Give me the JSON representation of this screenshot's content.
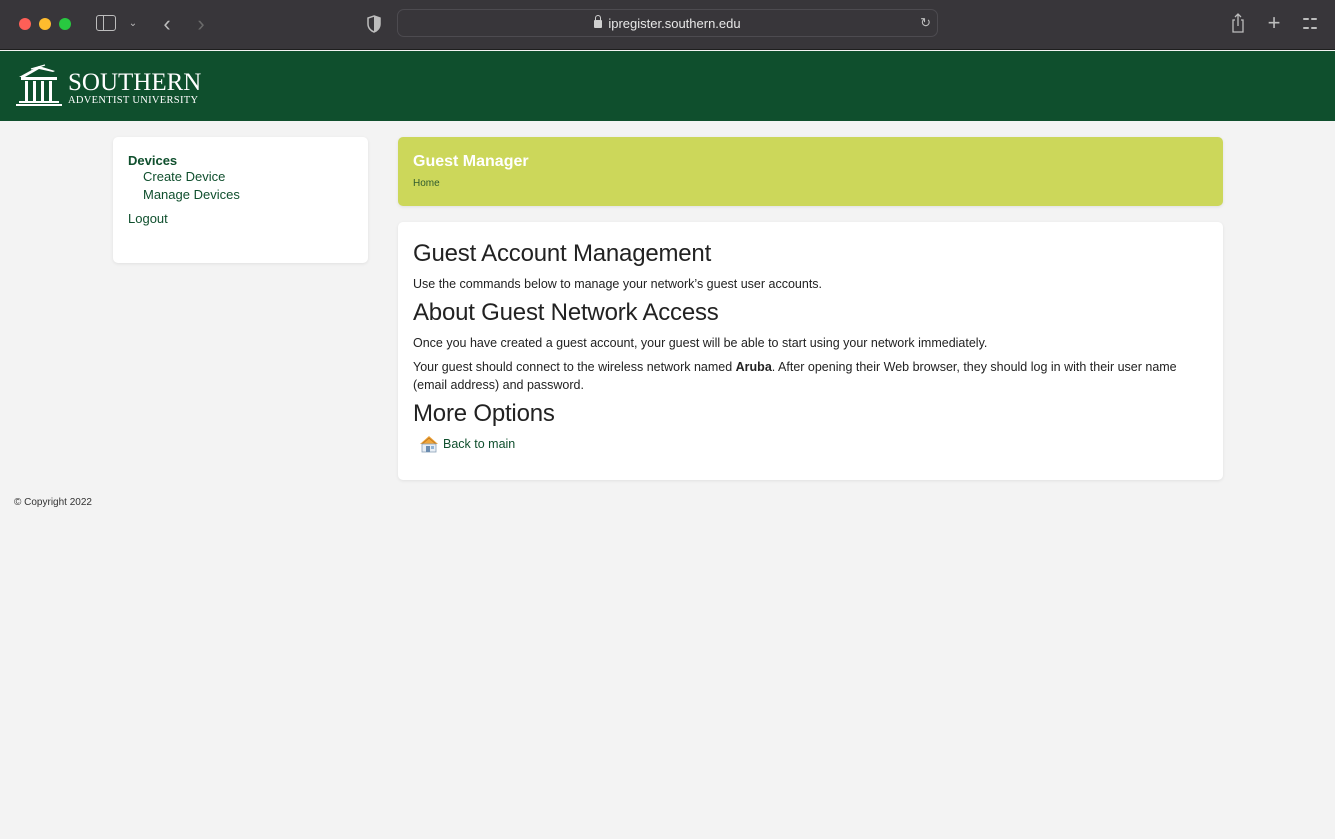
{
  "browser": {
    "url": "ipregister.southern.edu",
    "icons": [
      "sidebar-toggle-icon",
      "chevron-down-icon",
      "back-icon",
      "forward-icon",
      "shield-icon",
      "lock-icon",
      "reload-icon",
      "share-icon",
      "plus-icon",
      "tab-overview-icon"
    ]
  },
  "header": {
    "logo_main": "SOUTHERN",
    "logo_sub": "ADVENTIST UNIVERSITY"
  },
  "sidebar": {
    "section_title": "Devices",
    "items": [
      {
        "label": "Create Device"
      },
      {
        "label": "Manage Devices"
      }
    ],
    "logout_label": "Logout"
  },
  "title_box": {
    "title": "Guest Manager",
    "breadcrumb": "Home"
  },
  "content": {
    "heading1": "Guest Account Management",
    "intro": "Use the commands below to manage your network’s guest user accounts.",
    "heading2": "About Guest Network Access",
    "para1": "Once you have created a guest account, your guest will be able to start using your network immediately.",
    "para2_prefix": "Your guest should connect to the wireless network named ",
    "network_name": "Aruba",
    "para2_suffix": ". After opening their Web browser, they should log in with their user name (email address) and password.",
    "heading3": "More Options",
    "options": [
      {
        "icon": "home-icon",
        "label": "Back to main"
      }
    ]
  },
  "footer": {
    "copyright": "© Copyright 2022"
  },
  "colors": {
    "brand_green": "#0f4f2d",
    "title_lime": "#ccd75a",
    "page_bg": "#f3f3f3"
  }
}
